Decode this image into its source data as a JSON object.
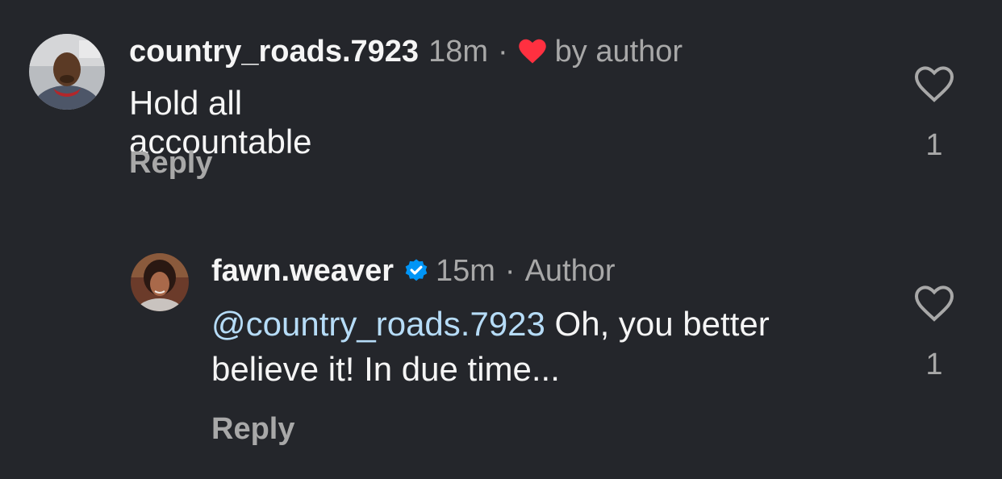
{
  "comments": [
    {
      "username": "country_roads.7923",
      "time": "18m",
      "separator": "·",
      "liked_by": "by author",
      "text": "Hold all accountable",
      "reply_label": "Reply",
      "likes": "1",
      "heart_color": "#ff3040"
    },
    {
      "username": "fawn.weaver",
      "time": "15m",
      "separator": "·",
      "badge": "Author",
      "mention": "@country_roads.7923",
      "text_line1": " Oh, you better",
      "text_line2": "believe it! In due time...",
      "reply_label": "Reply",
      "likes": "1",
      "verified_color": "#0095f6"
    }
  ]
}
